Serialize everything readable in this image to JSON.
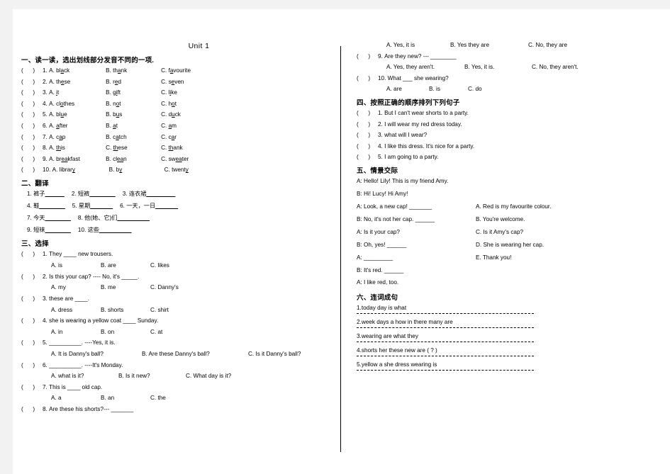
{
  "doc": {
    "title": "Unit 1"
  },
  "section1": {
    "heading": "一、读一读，选出划线部分发音不同的一项.",
    "items": [
      {
        "num": "1.",
        "a": "A. bl",
        "a_ul": "a",
        "a_end": "ck",
        "b": "B. th",
        "b_ul": "a",
        "b_end": "nk",
        "c": "C. f",
        "c_ul": "a",
        "c_end": "vourite"
      },
      {
        "num": "2.",
        "a": "A. th",
        "a_ul": "e",
        "a_end": "se",
        "b": "B. r",
        "b_ul": "e",
        "b_end": "d",
        "c": "C. s",
        "c_ul": "e",
        "c_end": "ven"
      },
      {
        "num": "3.",
        "a": "A. ",
        "a_ul": "i",
        "a_end": "t",
        "b": "B. g",
        "b_ul": "i",
        "b_end": "ft",
        "c": "C. l",
        "c_ul": "i",
        "c_end": "ke"
      },
      {
        "num": "4.",
        "a": "A. cl",
        "a_ul": "o",
        "a_end": "thes",
        "b": "B. n",
        "b_ul": "o",
        "b_end": "t",
        "c": "C. h",
        "c_ul": "o",
        "c_end": "t"
      },
      {
        "num": "5.",
        "a": "A. bl",
        "a_ul": "u",
        "a_end": "e",
        "b": "B. b",
        "b_ul": "u",
        "b_end": "s",
        "c": "C. d",
        "c_ul": "u",
        "c_end": "ck"
      },
      {
        "num": "6.",
        "a": "A. ",
        "a_ul": "a",
        "a_end": "fter",
        "b": "B. ",
        "b_ul": "a",
        "b_end": "t",
        "c": "C. ",
        "c_ul": "a",
        "c_end": "m"
      },
      {
        "num": "7.",
        "a": "A. c",
        "a_ul": "a",
        "a_end": "p",
        "b": "B. c",
        "b_ul": "a",
        "b_end": "tch",
        "c": "C. c",
        "c_ul": "a",
        "c_end": "r"
      },
      {
        "num": "8.",
        "a": "A. ",
        "a_ul": "th",
        "a_end": "is",
        "b": "C. ",
        "b_ul": "th",
        "b_end": "ese",
        "c": "C. ",
        "c_ul": "th",
        "c_end": "ank"
      },
      {
        "num": "9.",
        "a": "A. br",
        "a_ul": "ea",
        "a_end": "kfast",
        "b": "B. cl",
        "b_ul": "ea",
        "b_end": "n",
        "c": "C. sw",
        "c_ul": "ea",
        "c_end": "ter"
      },
      {
        "num": "10.",
        "a": "A. librar",
        "a_ul": "y",
        "a_end": "",
        "b": "B. b",
        "b_ul": "y",
        "b_end": "",
        "c": "C. twent",
        "c_ul": "y",
        "c_end": ""
      }
    ]
  },
  "section2": {
    "heading": "二、翻译",
    "rows": [
      {
        "i1": "1. 裤子",
        "b1": "______",
        "i2": "2. 短裤",
        "b2": "________",
        "i3": "3. 连衣裙",
        "b3": "_________"
      },
      {
        "i1": "4. 鞋",
        "b1": "________",
        "i2": "5. 星期",
        "b2": "_______",
        "i3": "6. 一天，一日",
        "b3": "_______"
      },
      {
        "i1": "7. 今天",
        "b1": "________",
        "i2": "8. 他(她、它)们",
        "b2": "__________",
        "i3": "",
        "b3": ""
      },
      {
        "i1": "9. 短袜",
        "b1": "________",
        "i2": "10. 这些",
        "b2": "__________",
        "i3": "",
        "b3": ""
      }
    ]
  },
  "section3": {
    "heading": "三、选择",
    "items": [
      {
        "num": "1.",
        "stem": "They ____ new trousers.",
        "a": "A. is",
        "b": "B. are",
        "c": "C. likes"
      },
      {
        "num": "2.",
        "stem": "Is this your cap? ---- No, it's _____.",
        "a": "A. my",
        "b": "B. me",
        "c": "C. Danny's"
      },
      {
        "num": "3.",
        "stem": "these are ____.",
        "a": "A. dress",
        "b": "B. shorts",
        "c": "C. shirt"
      },
      {
        "num": "4.",
        "stem": "she is wearing a yellow coat ____ Sunday.",
        "a": "A. in",
        "b": "B. on",
        "c": "C. at"
      },
      {
        "num": "5.",
        "stem": "__________. ----Yes, it is.",
        "a": "A. It is Danny's ball?",
        "b": "B. Are these Danny's ball?",
        "c": "C. Is it Danny's ball?"
      },
      {
        "num": "6.",
        "stem": "__________. ----It's Monday.",
        "a": "A. what is it?",
        "b": "B. Is it new?",
        "c": "C. What day is it?"
      },
      {
        "num": "7.",
        "stem": "This is ____ old cap.",
        "a": "A. a",
        "b": "B. an",
        "c": "C. the"
      },
      {
        "num": "8.",
        "stem": "Are these his shorts?--- _______",
        "a": "A. Yes, it is",
        "b": "B. Yes they are",
        "c": "C. No, they are"
      },
      {
        "num": "9.",
        "stem": "Are they new? --- ________",
        "a": "A. Yes, they aren't.",
        "b": "B. Yes, it is.",
        "c": "C. No, they aren't."
      },
      {
        "num": "10.",
        "stem": "What ___ she wearing?",
        "a": "A. are",
        "b": "B. is",
        "c": "C. do"
      }
    ]
  },
  "section4": {
    "heading": "四、按照正确的顺序排列下列句子",
    "items": [
      {
        "num": "1.",
        "text": "But I can't wear shorts to a party."
      },
      {
        "num": "2.",
        "text": "I will wear my red dress today."
      },
      {
        "num": "3.",
        "text": "what will I wear?"
      },
      {
        "num": "4.",
        "text": "I like this dress. It's nice for a party."
      },
      {
        "num": "5.",
        "text": "I am going to a party."
      }
    ]
  },
  "section5": {
    "heading": "五、情景交际",
    "lines": [
      {
        "left": "A: Hello! Lily! This is my friend Amy.",
        "right": ""
      },
      {
        "left": "B: Hi! Lucy! Hi Amy!",
        "right": ""
      },
      {
        "left": "A: Look, a new cap! _______",
        "right": "A. Red is my favourite colour."
      },
      {
        "left": "B: No, it's not her cap. ______",
        "right": "B. You're welcome."
      },
      {
        "left": "A: Is it your cap?",
        "right": "C. Is it Amy's cap?"
      },
      {
        "left": "B: Oh, yes! ______",
        "right": "D. She is wearing her cap."
      },
      {
        "left": "A: _________",
        "right": "E. Thank you!"
      },
      {
        "left": "B: It's red. ______",
        "right": ""
      },
      {
        "left": "A: I like red, too.",
        "right": ""
      }
    ]
  },
  "section6": {
    "heading": "六、连词成句",
    "items": [
      {
        "num": "1.",
        "words": "today        day      is    what"
      },
      {
        "num": "2.",
        "words": "week      days      a      how      in    there      many    are"
      },
      {
        "num": "3.",
        "words": "wearing      are     what       they"
      },
      {
        "num": "4.",
        "words": "shorts     her     these      new    are    ( ? )"
      },
      {
        "num": "5.",
        "words": "yellow      a      she      dress     wearing     is"
      }
    ]
  },
  "common": {
    "bracket_open": "(",
    "bracket_close": ")"
  }
}
